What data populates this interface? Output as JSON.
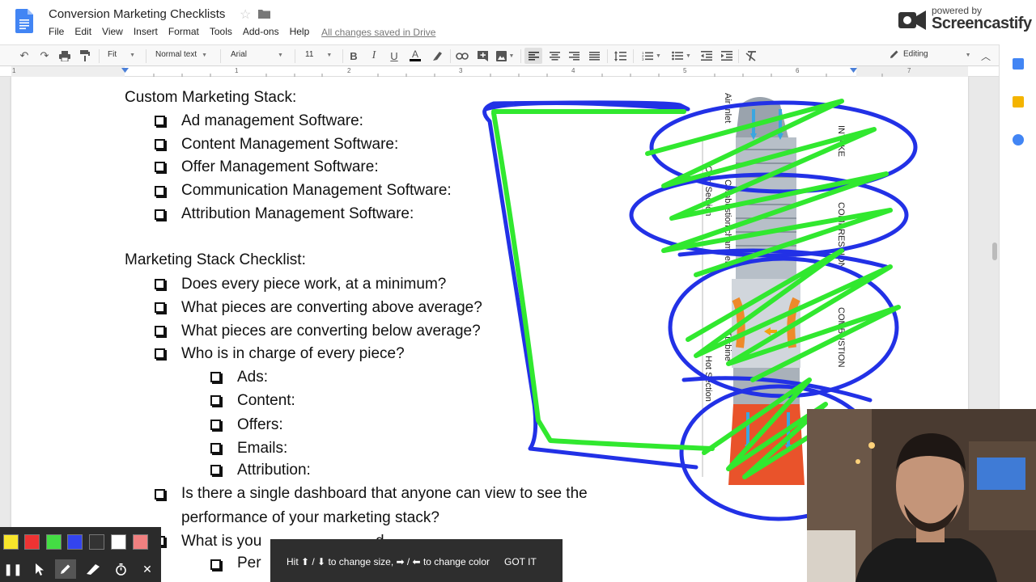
{
  "header": {
    "title": "Conversion Marketing Checklists",
    "menu": [
      "File",
      "Edit",
      "View",
      "Insert",
      "Format",
      "Tools",
      "Add-ons",
      "Help"
    ],
    "save_status": "All changes saved in Drive"
  },
  "watermark": {
    "powered": "powered by",
    "name": "Screencastify"
  },
  "toolbar": {
    "zoom": "Fit",
    "style": "Normal text",
    "font": "Arial",
    "size": "11",
    "mode": "Editing"
  },
  "ruler": {
    "numbers": [
      "1",
      "1",
      "2",
      "3",
      "4",
      "5",
      "6",
      "7"
    ]
  },
  "document": {
    "heading1": "Custom Marketing Stack:",
    "stack_items": [
      "Ad management Software:",
      "Content Management Software:",
      "Offer Management Software:",
      "Communication Management Software:",
      "Attribution Management Software:"
    ],
    "heading2": "Marketing Stack Checklist:",
    "checklist": [
      "Does every piece work, at a minimum?",
      "What pieces are converting above average?",
      "What pieces are converting below average?",
      "Who is in charge of every piece?"
    ],
    "sub_items": [
      "Ads:",
      "Content:",
      "Offers:",
      "Emails:",
      "Attribution:"
    ],
    "dashboard_line1": "Is there a single dashboard that anyone can view to see the",
    "dashboard_line2": "performance of your marketing stack?",
    "partial_line": "What is you",
    "partial_line_end": "d",
    "partial_sub": "Per"
  },
  "figure_labels": {
    "air_intake": "Air Inlet",
    "intake": "INTAKE",
    "cold_section": "Cold Section",
    "combustion_chamber": "Combustion chamber",
    "compression": "COMPRESSION",
    "combustion": "COMBUSTION",
    "turbine": "Turbine",
    "hot_section": "Hot Section"
  },
  "annotation_tool": {
    "colors": [
      "#f7e52b",
      "#ee3333",
      "#44dd44",
      "#3344ee",
      "#333333",
      "#ffffff",
      "#f08080"
    ]
  },
  "tip": {
    "text": "Hit ⬆ / ⬇ to change size, ➡ / ⬅ to change color",
    "button": "GOT IT"
  }
}
